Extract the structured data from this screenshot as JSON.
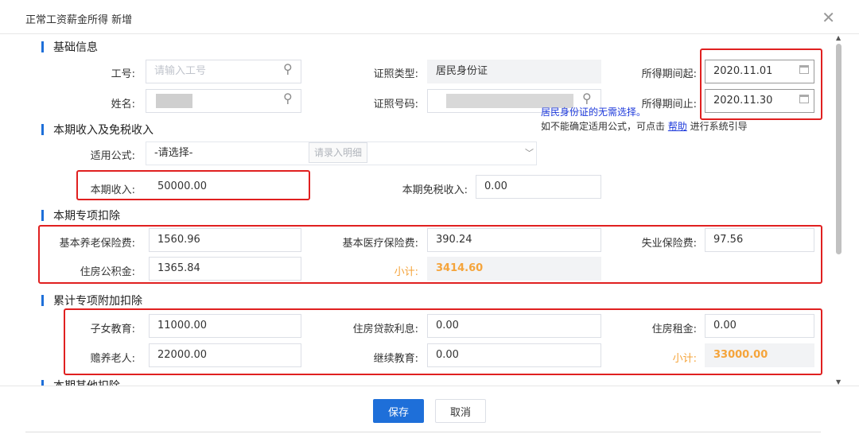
{
  "dialog": {
    "title": "正常工资薪金所得 新增",
    "close_icon": "close-icon"
  },
  "sections": {
    "basic": "基础信息",
    "income": "本期收入及免税收入",
    "special": "本期专项扣除",
    "cumulative": "累计专项附加扣除",
    "other": "本期其他扣除"
  },
  "basic": {
    "emp_no_label": "工号:",
    "emp_no_placeholder": "请输入工号",
    "name_label": "姓名:",
    "id_type_label": "证照类型:",
    "id_type_value": "居民身份证",
    "id_no_label": "证照号码:",
    "period_start_label": "所得期间起:",
    "period_start_value": "2020.11.01",
    "period_end_label": "所得期间止:",
    "period_end_value": "2020.11.30"
  },
  "income": {
    "formula_label": "适用公式:",
    "formula_value": "-请选择-",
    "hint_line1": "居民身份证的无需选择。",
    "hint_line2_prefix": "如不能确定适用公式，可点击 ",
    "hint_link": "帮助",
    "hint_line2_suffix": " 进行系统引导",
    "current_income_label": "本期收入:",
    "current_income_value": "50000.00",
    "detail_button": "请录入明细",
    "tax_free_label": "本期免税收入:",
    "tax_free_value": "0.00"
  },
  "special": {
    "pension_label": "基本养老保险费:",
    "pension_value": "1560.96",
    "medical_label": "基本医疗保险费:",
    "medical_value": "390.24",
    "unemployment_label": "失业保险费:",
    "unemployment_value": "97.56",
    "housing_fund_label": "住房公积金:",
    "housing_fund_value": "1365.84",
    "subtotal_label": "小计:",
    "subtotal_value": "3414.60"
  },
  "cumulative": {
    "children_label": "子女教育:",
    "children_value": "11000.00",
    "loan_label": "住房贷款利息:",
    "loan_value": "0.00",
    "rent_label": "住房租金:",
    "rent_value": "0.00",
    "elderly_label": "赡养老人:",
    "elderly_value": "22000.00",
    "continuing_label": "继续教育:",
    "continuing_value": "0.00",
    "subtotal_label": "小计:",
    "subtotal_value": "33000.00"
  },
  "footer": {
    "save": "保存",
    "cancel": "取消"
  },
  "colors": {
    "accent": "#1e6fd9",
    "highlight": "#e02020",
    "subtotal": "#f5a43b"
  }
}
